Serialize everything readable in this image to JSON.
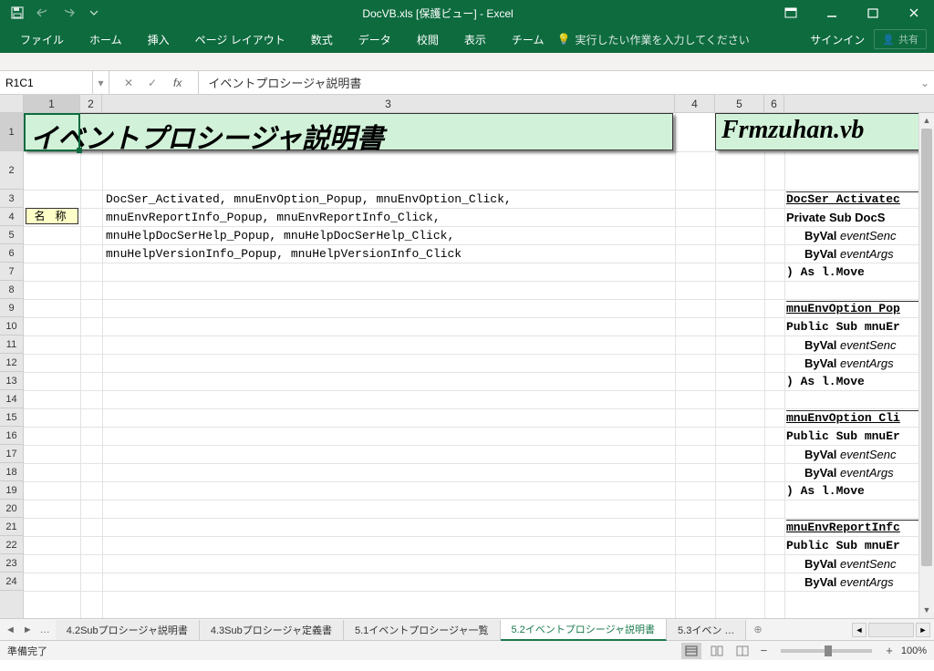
{
  "app": {
    "title": "DocVB.xls [保護ビュー] - Excel",
    "signin": "サインイン",
    "share": "共有"
  },
  "ribbon": {
    "tabs": [
      "ファイル",
      "ホーム",
      "挿入",
      "ページ レイアウト",
      "数式",
      "データ",
      "校閲",
      "表示",
      "チーム"
    ],
    "tellme": "実行したい作業を入力してください"
  },
  "formula": {
    "namebox": "R1C1",
    "content": "イベントプロシージャ説明書"
  },
  "columns": [
    "1",
    "2",
    "3",
    "4",
    "5",
    "6"
  ],
  "rows": [
    "1",
    "2",
    "3",
    "4",
    "5",
    "6",
    "7",
    "8",
    "9",
    "10",
    "11",
    "12",
    "13",
    "14",
    "15",
    "16",
    "17",
    "18",
    "19",
    "20",
    "21",
    "22",
    "23",
    "24"
  ],
  "cells": {
    "title_main": "イベントプロシージャ説明書",
    "title_right": "Frmzuhan.vb",
    "label_r3c1": "名 称",
    "r3c3": "DocSer_Activated, mnuEnvOption_Popup, mnuEnvOption_Click,",
    "r4c3": "mnuEnvReportInfo_Popup, mnuEnvReportInfo_Click,",
    "r5c3": "mnuHelpDocSerHelp_Popup, mnuHelpDocSerHelp_Click,",
    "r6c3": "mnuHelpVersionInfo_Popup, mnuHelpVersionInfo_Click",
    "right_block": {
      "b1_l1": "DocSer_Activatec",
      "b1_l2_a": "Private Sub DocS",
      "b1_l3_a": "ByVal ",
      "b1_l3_b": "eventSenc",
      "b1_l4_a": "ByVal ",
      "b1_l4_b": "eventArgs",
      "b1_l5": ") As l.Move",
      "b2_l1": "mnuEnvOption_Pop",
      "b2_l2": "Public Sub mnuEr",
      "b2_l3_a": "ByVal ",
      "b2_l3_b": "eventSenc",
      "b2_l4_a": "ByVal ",
      "b2_l4_b": "eventArgs",
      "b2_l5": ") As l.Move",
      "b3_l1": "mnuEnvOption_Cli",
      "b3_l2": "Public Sub mnuEr",
      "b3_l3_a": "ByVal ",
      "b3_l3_b": "eventSenc",
      "b3_l4_a": "ByVal ",
      "b3_l4_b": "eventArgs",
      "b3_l5": ") As l.Move",
      "b4_l1": "mnuEnvReportInfc",
      "b4_l2": "Public Sub mnuEr",
      "b4_l3_a": "ByVal ",
      "b4_l3_b": "eventSenc",
      "b4_l4_a": "ByVal ",
      "b4_l4_b": "eventArgs"
    }
  },
  "sheet_tabs": {
    "items": [
      "4.2Subプロシージャ説明書",
      "4.3Subプロシージャ定義書",
      "5.1イベントプロシージャ一覧",
      "5.2イベントプロシージャ説明書",
      "5.3イベン"
    ],
    "active_index": 3
  },
  "status": {
    "ready": "準備完了",
    "zoom": "100%"
  }
}
